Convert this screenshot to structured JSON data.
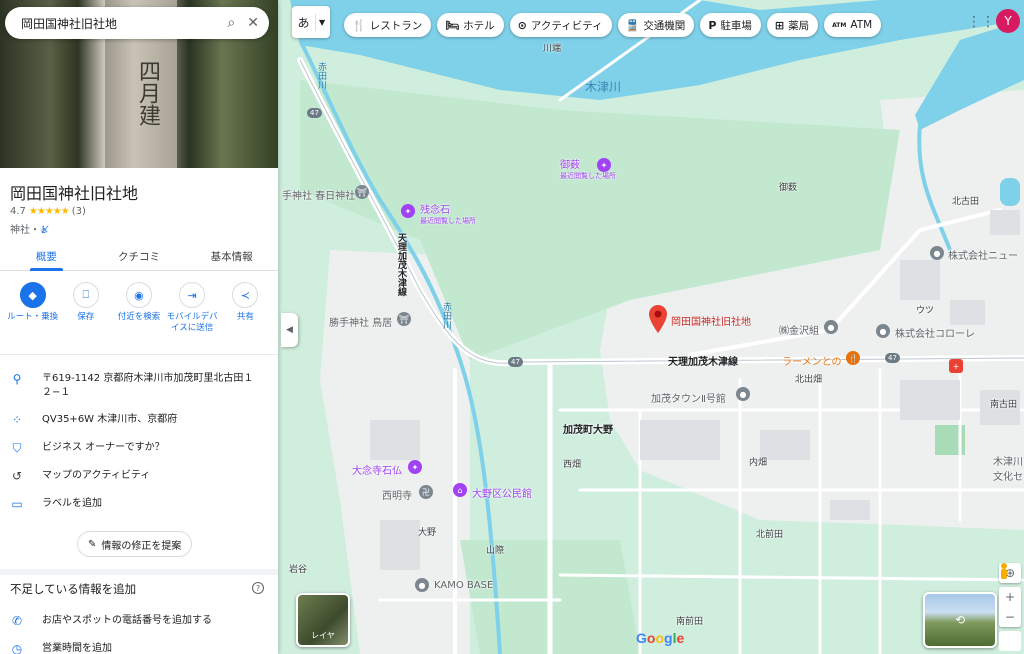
{
  "search": {
    "query": "岡田国神社旧社地"
  },
  "hero": {
    "chars": "四月建"
  },
  "place": {
    "title": "岡田国神社旧社地",
    "rating": "4.7",
    "stars": "★★★★★",
    "review_count": "(3)",
    "category": "神社・",
    "category_icon": "wheelchair-off-icon"
  },
  "tabs": [
    {
      "label": "概要",
      "active": true
    },
    {
      "label": "クチコミ",
      "active": false
    },
    {
      "label": "基本情報",
      "active": false
    }
  ],
  "actions": [
    {
      "label": "ルート・乗換",
      "icon": "directions-icon"
    },
    {
      "label": "保存",
      "icon": "bookmark-icon"
    },
    {
      "label": "付近を検索",
      "icon": "nearby-icon"
    },
    {
      "label": "モバイルデバイスに送信",
      "icon": "send-to-phone-icon"
    },
    {
      "label": "共有",
      "icon": "share-icon"
    }
  ],
  "info": {
    "address": "〒619-1142 京都府木津川市加茂町里北古田１２−１",
    "pluscode": "QV35+6W 木津川市、京都府",
    "owner": "ビジネス オーナーですか？",
    "activity": "マップのアクティビティ",
    "label": "ラベルを追加"
  },
  "suggest_edit": "情報の修正を提案",
  "missing": {
    "title": "不足している情報を追加",
    "phone": "お店やスポットの電話番号を追加する",
    "hours": "営業時間を追加"
  },
  "map": {
    "lang": "あ",
    "chips": [
      {
        "icon": "restaurant-icon",
        "glyph": "🍴",
        "label": "レストラン"
      },
      {
        "icon": "hotel-icon",
        "glyph": "🛏",
        "label": "ホテル"
      },
      {
        "icon": "camera-icon",
        "glyph": "⊙",
        "label": "アクティビティ"
      },
      {
        "icon": "train-icon",
        "glyph": "🚆",
        "label": "交通機関"
      },
      {
        "icon": "parking-icon",
        "glyph": "P",
        "label": "駐車場"
      },
      {
        "icon": "pharmacy-icon",
        "glyph": "⊞",
        "label": "薬局"
      },
      {
        "icon": "atm-icon",
        "glyph": "ATM",
        "label": "ATM"
      }
    ],
    "avatar": "Y",
    "layers_label": "レイヤ",
    "google": "Google",
    "labels": {
      "selected": "岡田国神社旧社地",
      "kizugawa": "木津川",
      "akatagawa": "赤田川",
      "akatagawa2": "赤田川",
      "kawabata": "川端",
      "gosaki": "御薮",
      "gosaki_sub": "最近閲覧した場所",
      "gosaki2": "御薮",
      "zannenishi": "残念石",
      "zannenishi_sub": "最近閲覧した場所",
      "kasugajinja": "手神社 春日神社",
      "kitakoda": "北古田",
      "tenri_v": "天理加茂木津線",
      "tenri_h": "天理加茂木津線",
      "route47a": "47",
      "route47b": "47",
      "route47c": "47",
      "kyoeisha": "株式会社ニュー",
      "utsu": "ウツ",
      "katte_torii": "勝手神社 鳥居",
      "kanezawa": "㈱金沢組",
      "korore": "株式会社コローレ",
      "ramen": "ラーメンとの",
      "kitade": "北出畑",
      "kamotown": "加茂タウンⅡ号館",
      "minamikoda": "南古田",
      "kamo_ono": "加茂町大野",
      "nishihata": "西畑",
      "uchihata": "内畑",
      "kizugawa_bunka": "木津川 文化セ",
      "dainenji": "大念寺石仏",
      "saimyoji": "西明寺",
      "ono_kominkan": "大野区公民館",
      "ono": "大野",
      "kitamaeda": "北前田",
      "yamaguchi": "山際",
      "iwatani": "岩谷",
      "kamobase": "KAMO BASE",
      "minamimaeda": "南前田"
    }
  }
}
